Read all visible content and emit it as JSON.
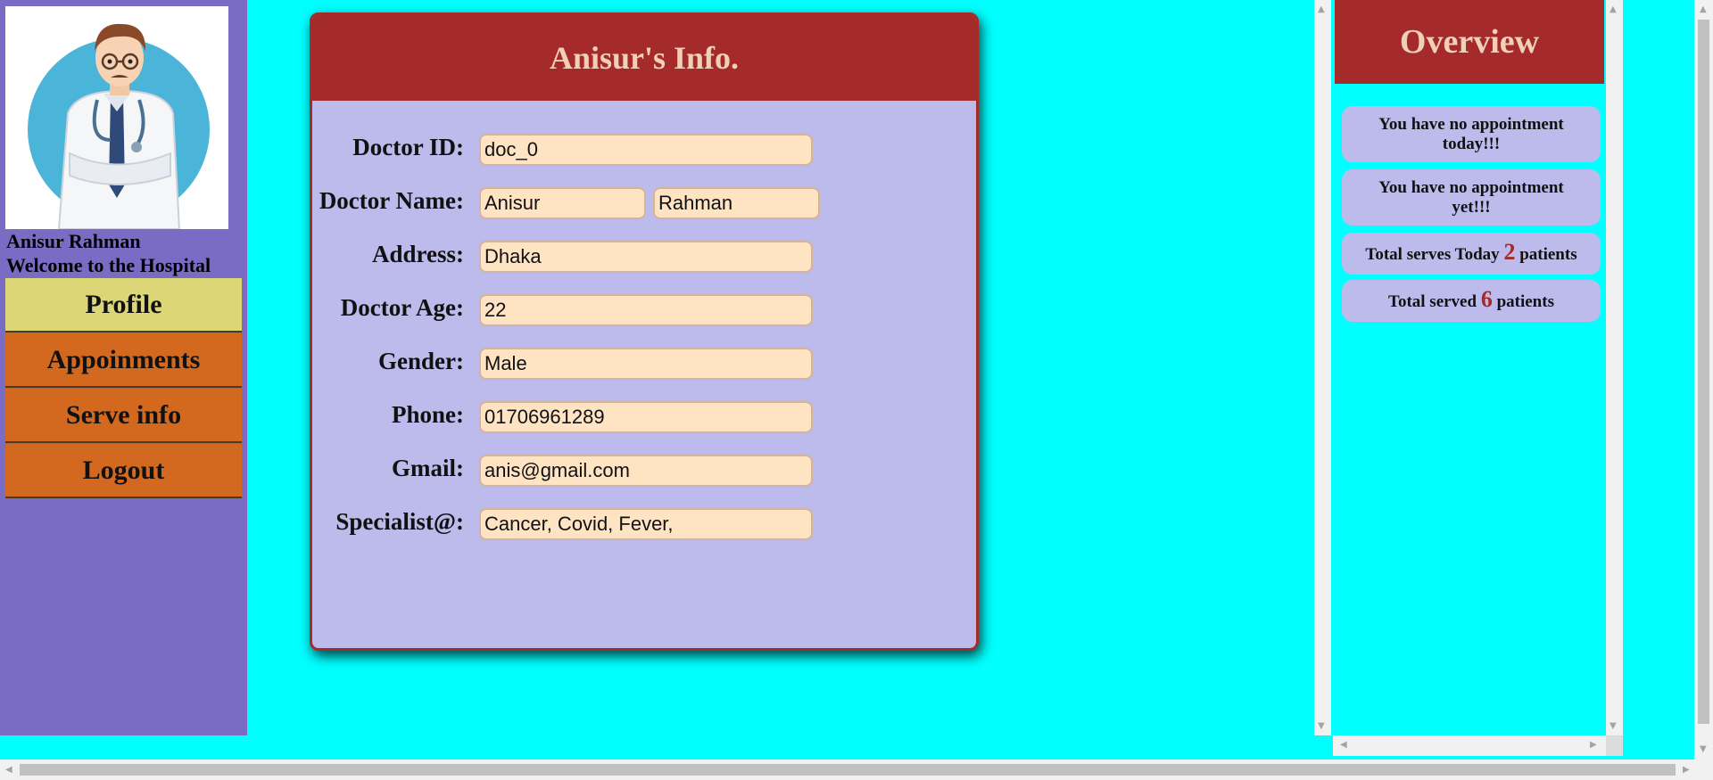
{
  "sidebar": {
    "user_name": "Anisur Rahman",
    "welcome": "Welcome to the Hospital",
    "avatar_icon": "doctor-avatar",
    "nav": [
      {
        "label": "Profile",
        "color": "#dcd676"
      },
      {
        "label": "Appoinments",
        "color": "#d2691e"
      },
      {
        "label": "Serve info",
        "color": "#d2691e"
      },
      {
        "label": "Logout",
        "color": "#d2691e"
      }
    ]
  },
  "info": {
    "title": "Anisur's Info.",
    "fields": [
      {
        "label": "Doctor ID:",
        "value": "doc_0"
      },
      {
        "label": "Doctor Name:",
        "first": "Anisur",
        "last": "Rahman"
      },
      {
        "label": "Address:",
        "value": "Dhaka"
      },
      {
        "label": "Doctor Age:",
        "value": "22"
      },
      {
        "label": "Gender:",
        "value": "Male"
      },
      {
        "label": "Phone:",
        "value": "01706961289"
      },
      {
        "label": "Gmail:",
        "value": "anis@gmail.com"
      },
      {
        "label": "Specialist@:",
        "value": "Cancer, Covid, Fever,"
      }
    ]
  },
  "overview": {
    "title": "Overview",
    "no_appt_today": "You have no appointment today!!!",
    "no_appt_yet": "You have no appointment yet!!!",
    "today_prefix": "Total serves Today",
    "today_count": "2",
    "today_suffix": "patients",
    "total_prefix": "Total served",
    "total_count": "6",
    "total_suffix": "patients"
  },
  "colors": {
    "page_bg": "#00ffff",
    "sidebar_bg": "#7a6cc4",
    "header_bg": "#a52a2a",
    "card_bg": "#bcbbec",
    "input_bg": "#ffe4c4"
  }
}
